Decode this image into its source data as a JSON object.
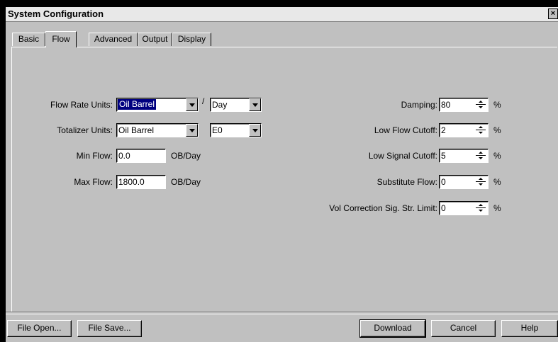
{
  "window": {
    "title": "System Configuration",
    "close_glyph": "×"
  },
  "tabs": [
    {
      "label": "Basic",
      "active": false
    },
    {
      "label": "Flow",
      "active": true
    },
    {
      "label": "Advanced",
      "active": false
    },
    {
      "label": "Output",
      "active": false
    },
    {
      "label": "Display",
      "active": false
    }
  ],
  "left": {
    "flow_rate_units": {
      "label": "Flow Rate Units:",
      "value": "Oil Barrel",
      "separator": "/",
      "time_value": "Day"
    },
    "totalizer_units": {
      "label": "Totalizer Units:",
      "value": "Oil Barrel",
      "exponent_value": "E0"
    },
    "min_flow": {
      "label": "Min Flow:",
      "value": "0.0",
      "unit": "OB/Day"
    },
    "max_flow": {
      "label": "Max Flow:",
      "value": "1800.0",
      "unit": "OB/Day"
    }
  },
  "right": {
    "damping": {
      "label": "Damping:",
      "value": "80",
      "unit": "%"
    },
    "low_flow_cutoff": {
      "label": "Low Flow Cutoff:",
      "value": "2",
      "unit": "%"
    },
    "low_signal_cutoff": {
      "label": "Low Signal Cutoff:",
      "value": "5",
      "unit": "%"
    },
    "substitute_flow": {
      "label": "Substitute Flow:",
      "value": "0",
      "unit": "%"
    },
    "vol_correction": {
      "label": "Vol Correction Sig. Str. Limit:",
      "value": "0",
      "unit": "%"
    }
  },
  "buttons": {
    "file_open": "File Open...",
    "file_save": "File Save...",
    "download": "Download",
    "cancel": "Cancel",
    "help": "Help"
  }
}
